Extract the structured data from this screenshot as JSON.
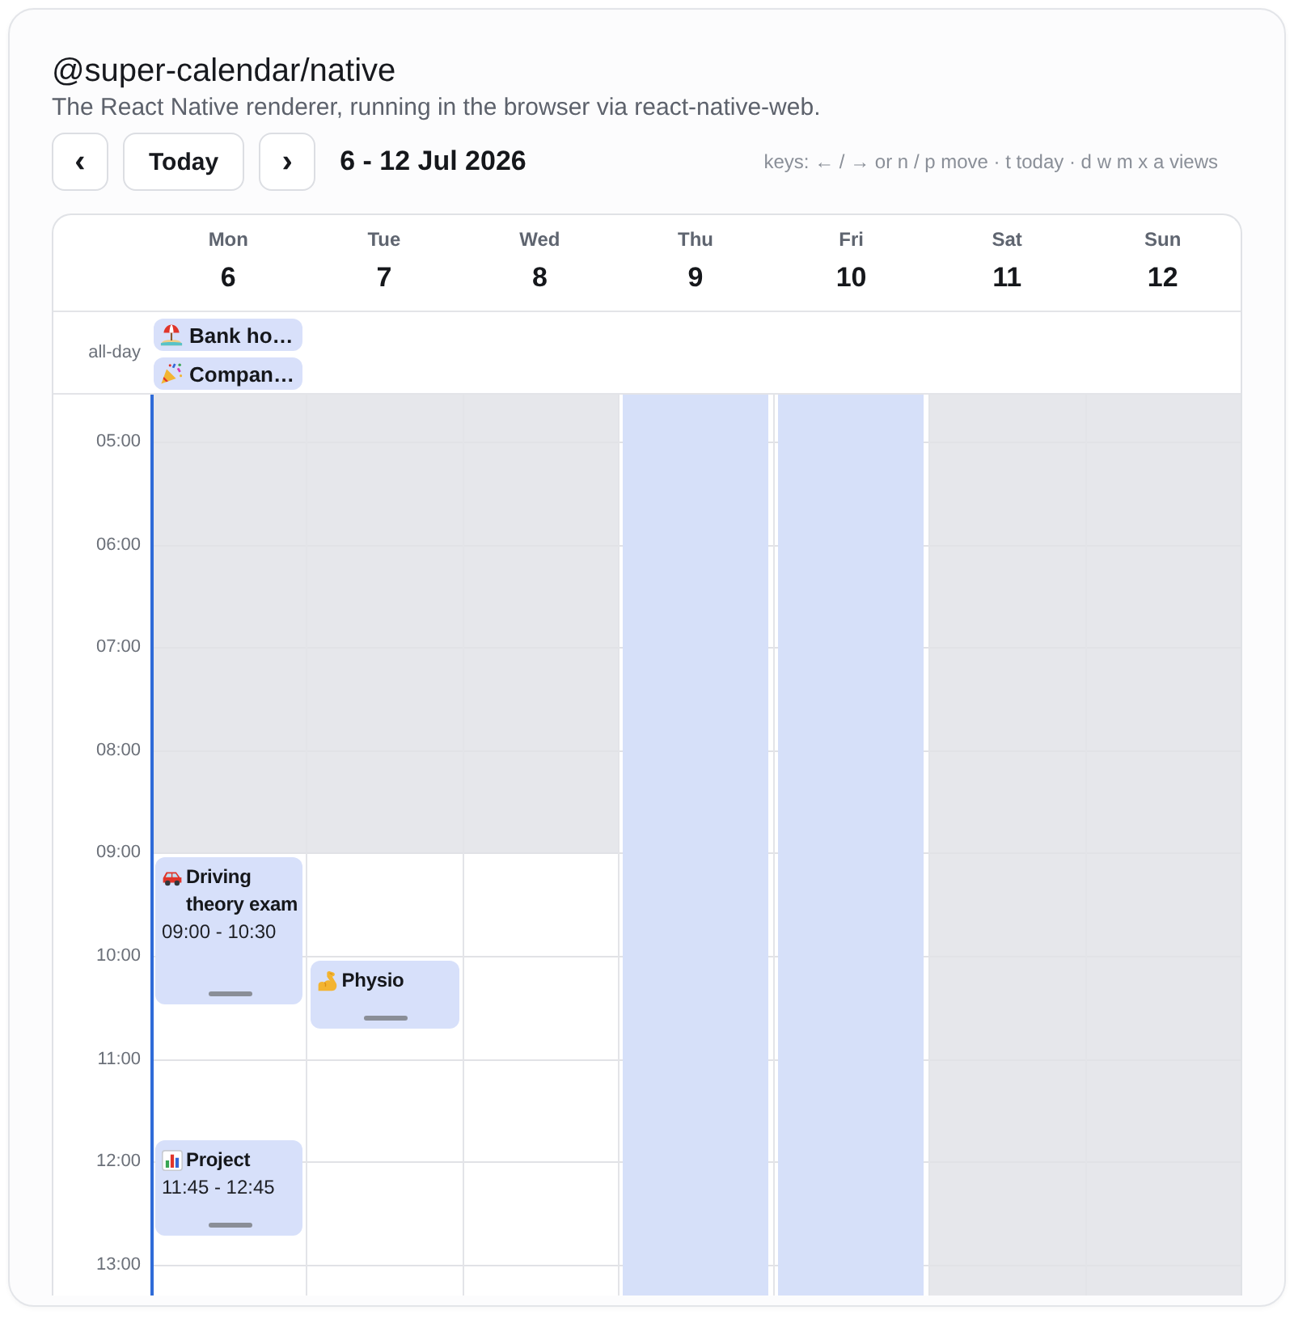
{
  "header": {
    "title": "@super-calendar/native",
    "subtitle": "The React Native renderer, running in the browser via react-native-web."
  },
  "toolbar": {
    "prev_button": "‹",
    "today_button": "Today",
    "next_button": "›",
    "date_range": "6 - 12 Jul 2026",
    "keys_hint": "keys: ← / → or n / p move · t today · d w m x a views"
  },
  "calendar": {
    "all_day_label": "all-day",
    "hours": [
      {
        "label": "05:00"
      },
      {
        "label": "06:00"
      },
      {
        "label": "07:00"
      },
      {
        "label": "08:00"
      },
      {
        "label": "09:00"
      },
      {
        "label": "10:00"
      },
      {
        "label": "11:00"
      },
      {
        "label": "12:00"
      },
      {
        "label": "13:00"
      }
    ],
    "days": [
      {
        "name": "Mon",
        "number": "6",
        "selected": false,
        "focused": true,
        "all_day": [
          {
            "title": "Bank ho…",
            "kind": "holiday"
          },
          {
            "title": "Compan…",
            "kind": "party"
          }
        ],
        "slots": [
          {
            "off_hours": true
          },
          {
            "off_hours": true
          },
          {
            "off_hours": true
          },
          {
            "off_hours": true
          },
          {
            "off_hours": true
          },
          {
            "off_hours": false,
            "events": [
              {
                "title": "Driving theory exam",
                "time": "09:00 - 10:30",
                "kind": "driving"
              }
            ]
          },
          {
            "off_hours": false
          },
          {
            "off_hours": false,
            "events": [
              {
                "title": "Project",
                "time": "11:45 - 12:45",
                "kind": "project"
              }
            ]
          },
          {
            "off_hours": false
          },
          {
            "off_hours": false
          }
        ]
      },
      {
        "name": "Tue",
        "number": "7",
        "selected": false,
        "focused": false,
        "slots": [
          {
            "off_hours": true
          },
          {
            "off_hours": true
          },
          {
            "off_hours": true
          },
          {
            "off_hours": true
          },
          {
            "off_hours": true
          },
          {
            "off_hours": false
          },
          {
            "off_hours": false,
            "events": [
              {
                "title": "Physio",
                "kind": "fitness"
              }
            ]
          },
          {
            "off_hours": false
          },
          {
            "off_hours": false
          },
          {
            "off_hours": false
          }
        ]
      },
      {
        "name": "Wed",
        "number": "8",
        "selected": false,
        "focused": false,
        "slots": [
          {
            "off_hours": true
          },
          {
            "off_hours": true
          },
          {
            "off_hours": true
          },
          {
            "off_hours": true
          },
          {
            "off_hours": true
          },
          {
            "off_hours": false
          },
          {
            "off_hours": false
          },
          {
            "off_hours": false
          },
          {
            "off_hours": false
          },
          {
            "off_hours": false
          }
        ]
      },
      {
        "name": "Thu",
        "number": "9",
        "selected": true,
        "focused": false
      },
      {
        "name": "Fri",
        "number": "10",
        "selected": true,
        "focused": false
      },
      {
        "name": "Sat",
        "number": "11",
        "selected": false,
        "focused": false,
        "slots": [
          {
            "off_hours": true
          },
          {
            "off_hours": true
          },
          {
            "off_hours": true
          },
          {
            "off_hours": true
          },
          {
            "off_hours": true
          },
          {
            "off_hours": true
          },
          {
            "off_hours": true
          },
          {
            "off_hours": true
          },
          {
            "off_hours": true
          },
          {
            "off_hours": true
          }
        ]
      },
      {
        "name": "Sun",
        "number": "12",
        "selected": false,
        "focused": false,
        "slots": [
          {
            "off_hours": true
          },
          {
            "off_hours": true
          },
          {
            "off_hours": true
          },
          {
            "off_hours": true
          },
          {
            "off_hours": true
          },
          {
            "off_hours": true
          },
          {
            "off_hours": true
          },
          {
            "off_hours": true
          },
          {
            "off_hours": true
          },
          {
            "off_hours": true
          }
        ]
      }
    ]
  }
}
